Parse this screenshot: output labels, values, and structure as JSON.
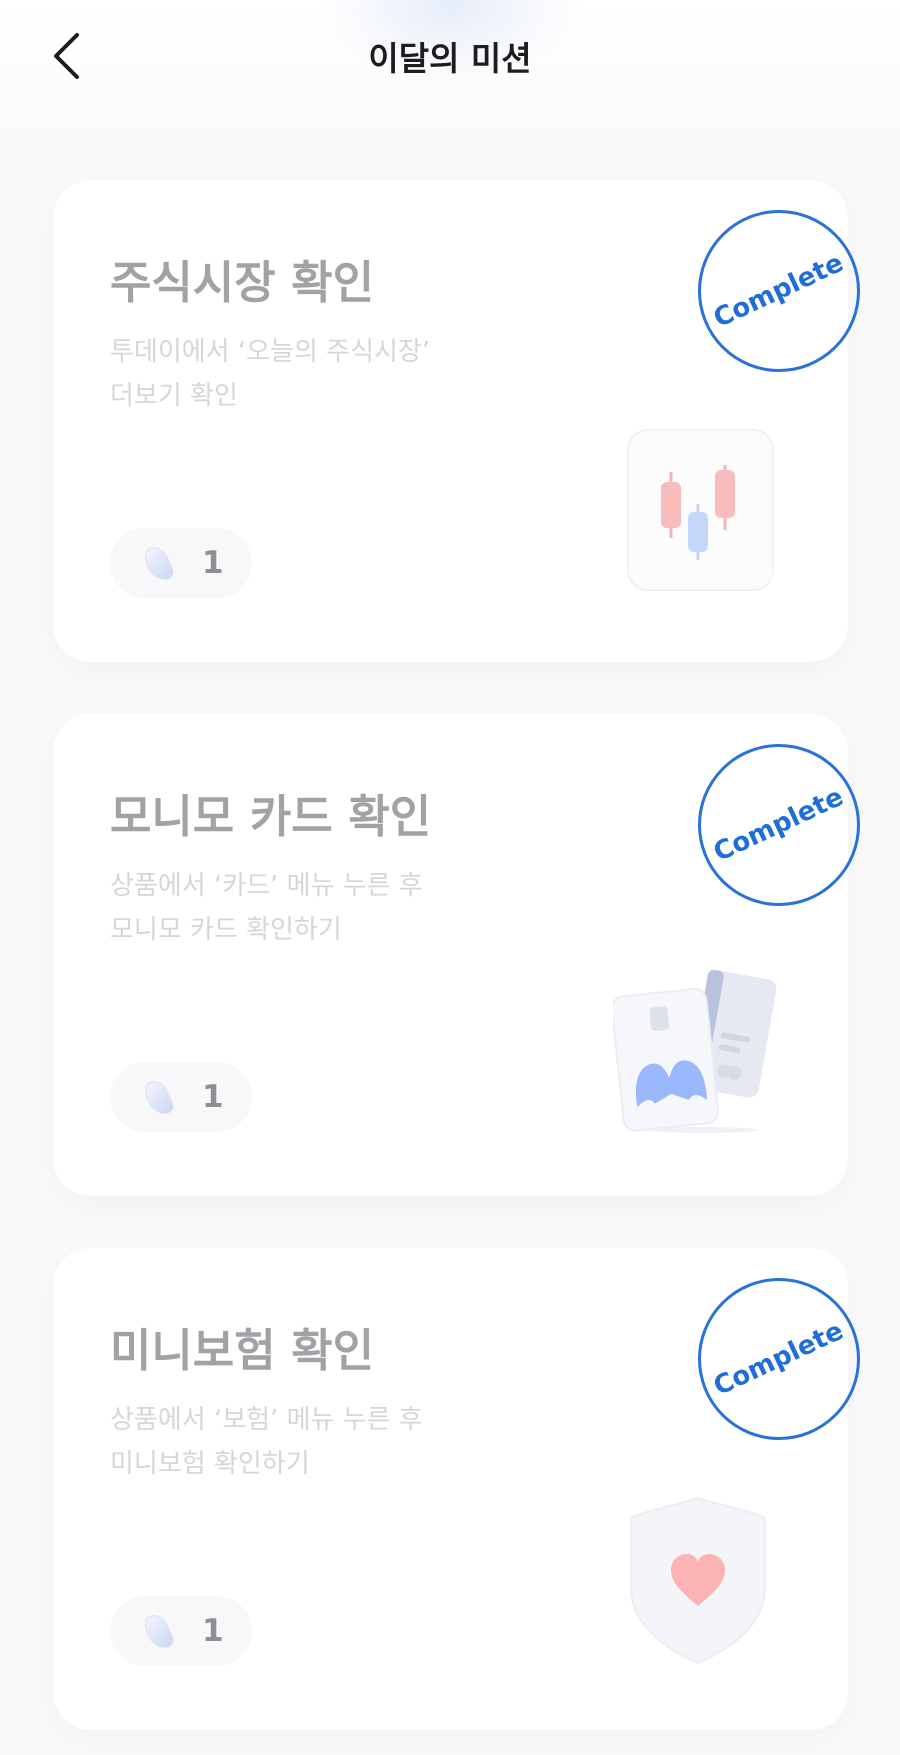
{
  "header": {
    "title": "이달의 미션"
  },
  "missions": [
    {
      "title": "주식시장 확인",
      "desc_line1": "투데이에서 ‘오늘의 주식시장’",
      "desc_line2": "더보기 확인",
      "reward_count": "1",
      "stamp": "Complete",
      "illustration": "candlestick-chart"
    },
    {
      "title": "모니모 카드 확인",
      "desc_line1": "상품에서 ‘카드’ 메뉴 누른 후",
      "desc_line2": "모니모 카드 확인하기",
      "reward_count": "1",
      "stamp": "Complete",
      "illustration": "credit-cards"
    },
    {
      "title": "미니보험 확인",
      "desc_line1": "상품에서 ‘보험’ 메뉴 누른 후",
      "desc_line2": "미니보험 확인하기",
      "reward_count": "1",
      "stamp": "Complete",
      "illustration": "shield-heart"
    }
  ],
  "colors": {
    "stamp_blue": "#2a72d8",
    "title_gray": "#a2a2a6",
    "desc_gray": "#d6d6da"
  }
}
